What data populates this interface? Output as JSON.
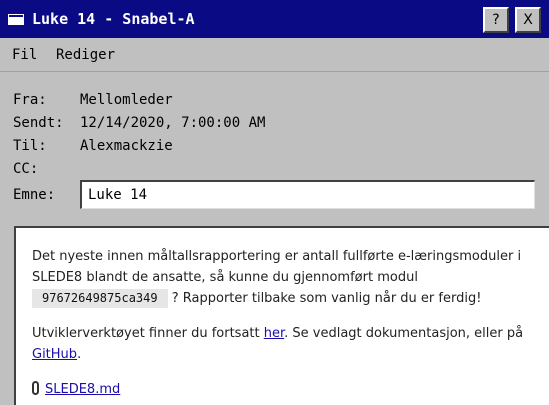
{
  "window": {
    "title": "Luke 14 - Snabel-A",
    "help_label": "?",
    "close_label": "X"
  },
  "menu": {
    "items": [
      {
        "label": "Fil"
      },
      {
        "label": "Rediger"
      }
    ]
  },
  "header": {
    "from_label": "Fra:",
    "from_value": "Mellomleder",
    "sent_label": "Sendt:",
    "sent_value": "12/14/2020, 7:00:00 AM",
    "to_label": "Til:",
    "to_value": "Alexmackzie",
    "cc_label": "CC:",
    "cc_value": "",
    "subject_label": "Emne:",
    "subject_value": "Luke 14"
  },
  "body": {
    "p1_before_code": "Det nyeste innen måltallsrapportering er antall fullførte e-læringsmoduler i SLEDE8 blandt de ansatte, så kunne du gjennomført modul",
    "p1_code": "97672649875ca349",
    "p1_after_code": "? Rapporter tilbake som vanlig når du er ferdig!",
    "p2_before_link1": "Utviklerverktøyet finner du fortsatt",
    "p2_link1": "her",
    "p2_between": ". Se vedlagt dokumentasjon, eller på",
    "p2_link2": "GitHub",
    "p2_end": ".",
    "attachment_name": "SLEDE8.md"
  }
}
